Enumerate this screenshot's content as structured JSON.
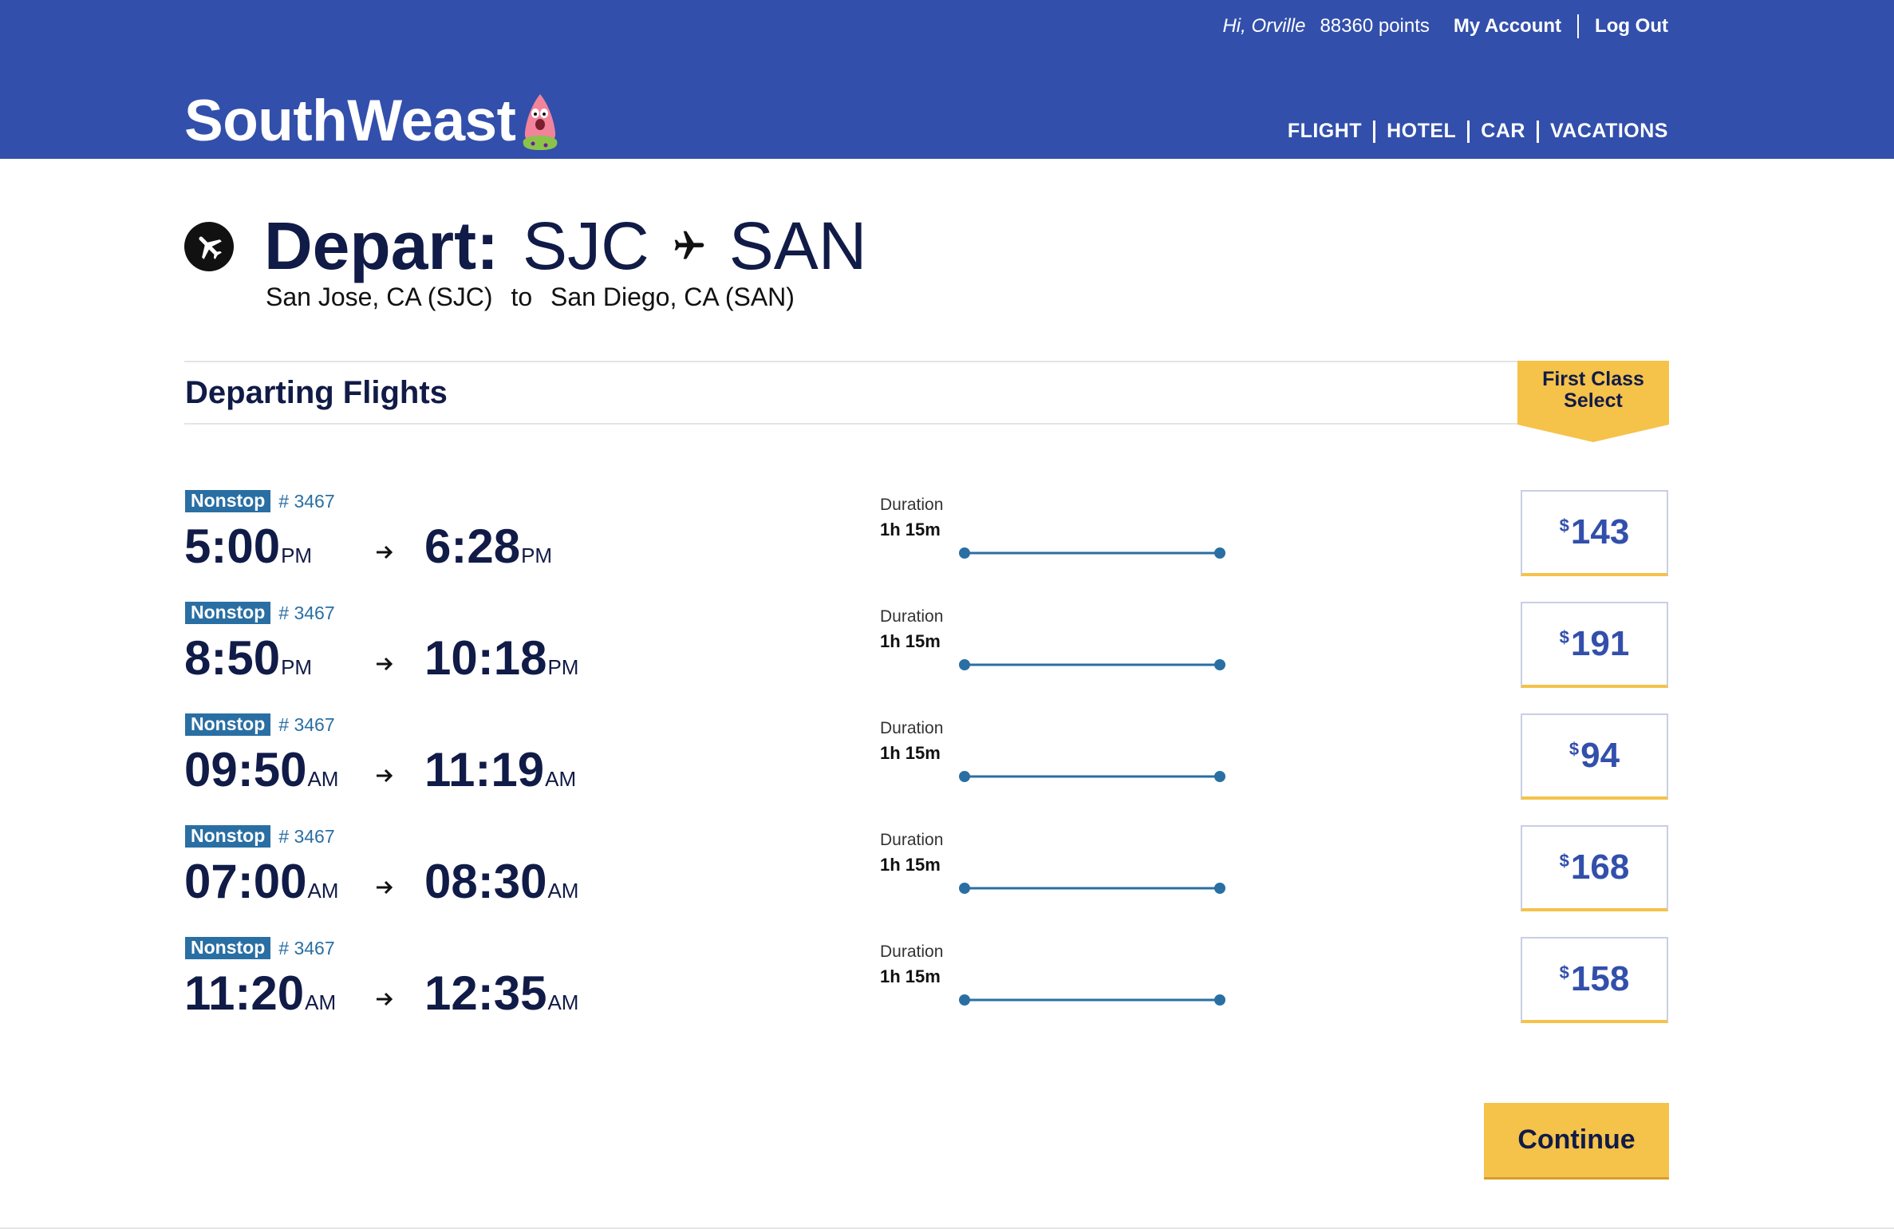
{
  "header": {
    "greeting": "Hi, Orville",
    "points": "88360 points",
    "my_account": "My Account",
    "log_out": "Log Out",
    "logo_text": "SouthWeast",
    "nav": [
      "FLIGHT",
      "HOTEL",
      "CAR",
      "VACATIONS"
    ]
  },
  "trip": {
    "depart_label": "Depart:",
    "origin_code": "SJC",
    "destination_code": "SAN",
    "origin_full": "San Jose, CA (SJC)",
    "to_word": "to",
    "destination_full": "San Diego, CA (SAN)"
  },
  "section": {
    "title": "Departing Flights",
    "fare_tab_line1": "First Class",
    "fare_tab_line2": "Select"
  },
  "flights": [
    {
      "badge": "Nonstop",
      "number": "# 3467",
      "dep_time": "5:00",
      "dep_ampm": "PM",
      "arr_time": "6:28",
      "arr_ampm": "PM",
      "duration_label": "Duration",
      "duration": "1h 15m",
      "currency": "$",
      "price": "143"
    },
    {
      "badge": "Nonstop",
      "number": "# 3467",
      "dep_time": "8:50",
      "dep_ampm": "PM",
      "arr_time": "10:18",
      "arr_ampm": "PM",
      "duration_label": "Duration",
      "duration": "1h 15m",
      "currency": "$",
      "price": "191"
    },
    {
      "badge": "Nonstop",
      "number": "# 3467",
      "dep_time": "09:50",
      "dep_ampm": "AM",
      "arr_time": "11:19",
      "arr_ampm": "AM",
      "duration_label": "Duration",
      "duration": "1h 15m",
      "currency": "$",
      "price": "94"
    },
    {
      "badge": "Nonstop",
      "number": "# 3467",
      "dep_time": "07:00",
      "dep_ampm": "AM",
      "arr_time": "08:30",
      "arr_ampm": "AM",
      "duration_label": "Duration",
      "duration": "1h 15m",
      "currency": "$",
      "price": "168"
    },
    {
      "badge": "Nonstop",
      "number": "# 3467",
      "dep_time": "11:20",
      "dep_ampm": "AM",
      "arr_time": "12:35",
      "arr_ampm": "AM",
      "duration_label": "Duration",
      "duration": "1h 15m",
      "currency": "$",
      "price": "158"
    }
  ],
  "actions": {
    "continue_label": "Continue"
  },
  "colors": {
    "header_blue": "#324fab",
    "navy_text": "#111b47",
    "nonstop_blue": "#2a6fa3",
    "accent_yellow": "#f5c24a"
  },
  "icons": {
    "title_icon": "airplane-circle-icon",
    "route_icon": "airplane-icon",
    "row_icon": "arrow-right-icon",
    "mascot": "mascot-icon"
  }
}
